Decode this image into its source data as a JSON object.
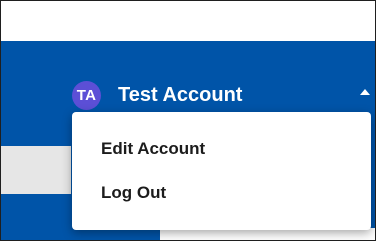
{
  "account": {
    "initials": "TA",
    "name": "Test Account",
    "avatar_color": "#5c4fd6",
    "caret_icon": "caret-up-icon"
  },
  "menu": {
    "items": [
      {
        "label": "Edit Account"
      },
      {
        "label": "Log Out"
      }
    ]
  },
  "colors": {
    "header_blue": "#0054a8",
    "menu_text": "#1c1c1c"
  }
}
